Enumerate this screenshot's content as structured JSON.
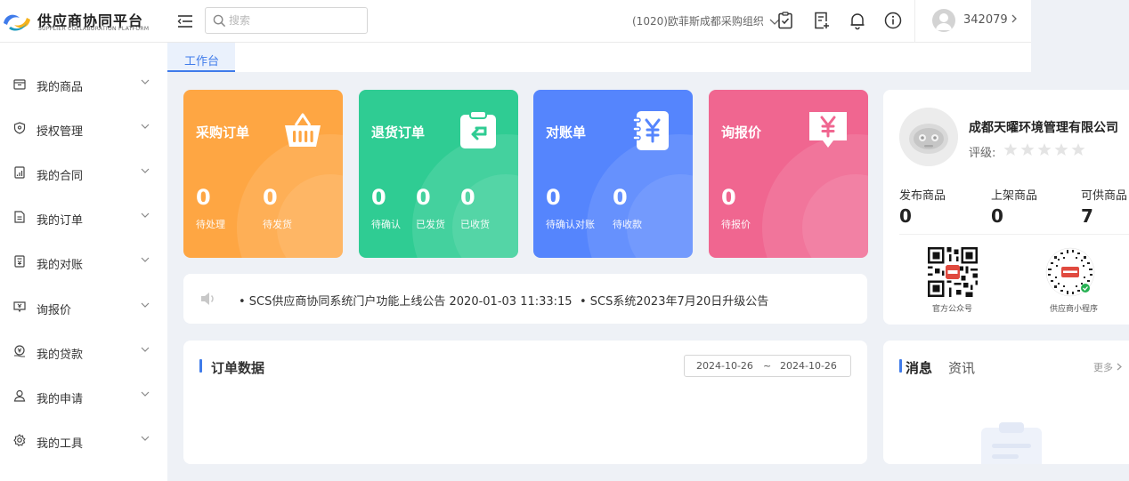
{
  "brand": {
    "title": "供应商协同平台",
    "subtitle": "SUPPLIER COLLABORATION PLATFORM",
    "colors": {
      "blue": "#3f7bea",
      "yellow": "#f5b21b",
      "teal": "#1d9bbd"
    }
  },
  "header": {
    "search_placeholder": "搜索",
    "org": "(1020)欧菲斯成都采购组织",
    "icons": [
      "clipboard-check-icon",
      "document-add-icon",
      "bell-icon",
      "info-icon"
    ],
    "user_id": "342079"
  },
  "sidebar": {
    "items": [
      {
        "label": "我的商品",
        "icon": "box-icon"
      },
      {
        "label": "授权管理",
        "icon": "shield-icon"
      },
      {
        "label": "我的合同",
        "icon": "contract-icon"
      },
      {
        "label": "我的订单",
        "icon": "order-icon"
      },
      {
        "label": "我的对账",
        "icon": "reconcile-icon"
      },
      {
        "label": "询报价",
        "icon": "quote-icon"
      },
      {
        "label": "我的贷款",
        "icon": "loan-icon"
      },
      {
        "label": "我的申请",
        "icon": "user-apply-icon"
      },
      {
        "label": "我的工具",
        "icon": "tools-icon"
      }
    ]
  },
  "tabs": [
    {
      "label": "工作台",
      "active": true
    }
  ],
  "cards": [
    {
      "title": "采购订单",
      "color": "#fea643",
      "icon": "basket-icon",
      "stats": [
        {
          "value": "0",
          "label": "待处理"
        },
        {
          "value": "0",
          "label": "待发货"
        }
      ]
    },
    {
      "title": "退货订单",
      "color": "#2fcc93",
      "icon": "return-icon",
      "stats": [
        {
          "value": "0",
          "label": "待确认"
        },
        {
          "value": "0",
          "label": "已发货"
        },
        {
          "value": "0",
          "label": "已收货"
        }
      ]
    },
    {
      "title": "对账单",
      "color": "#5585fd",
      "icon": "yen-book-icon",
      "stats": [
        {
          "value": "0",
          "label": "待确认对账"
        },
        {
          "value": "0",
          "label": "待收款"
        }
      ]
    },
    {
      "title": "询报价",
      "color": "#f06690",
      "icon": "yen-chat-icon",
      "stats": [
        {
          "value": "0",
          "label": "待报价"
        }
      ]
    }
  ],
  "announcements": [
    "• SCS供应商协同系统门户功能上线公告 2020-01-03 11:33:15",
    "• SCS系统2023年7月20日升级公告"
  ],
  "orders": {
    "title": "订单数据",
    "date_from": "2024-10-26",
    "date_sep": "~",
    "date_to": "2024-10-26"
  },
  "company": {
    "name": "成都天曜环境管理有限公司",
    "rating_label": "评级:",
    "rating": 0,
    "rating_max": 5,
    "stats": [
      {
        "label": "发布商品",
        "value": "0"
      },
      {
        "label": "上架商品",
        "value": "0"
      },
      {
        "label": "可供商品",
        "value": "7"
      }
    ],
    "qr": [
      {
        "label": "官方公众号"
      },
      {
        "label": "供应商小程序"
      }
    ]
  },
  "messages": {
    "tab_messages": "消息",
    "tab_news": "资讯",
    "more": "更多"
  }
}
